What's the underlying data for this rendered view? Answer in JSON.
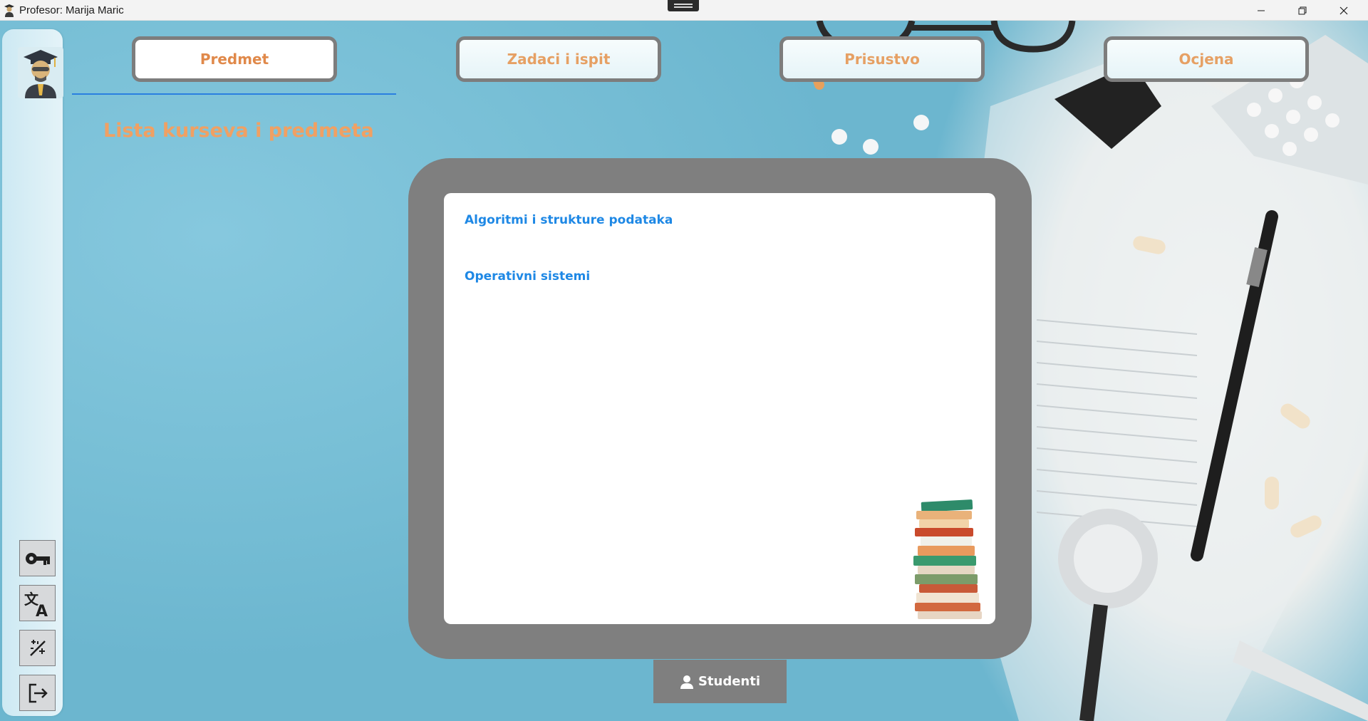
{
  "window": {
    "title": "Profesor: Marija Maric",
    "controls": {
      "minimize_icon": "minimize-icon",
      "maximize_icon": "restore-icon",
      "close_icon": "close-icon"
    }
  },
  "tabs": [
    {
      "label": "Predmet",
      "active": true
    },
    {
      "label": "Zadaci i ispit",
      "active": false
    },
    {
      "label": "Prisustvo",
      "active": false
    },
    {
      "label": "Ocjena",
      "active": false
    }
  ],
  "section_title": "Lista kurseva i predmeta",
  "courses": [
    "Algoritmi i strukture podataka",
    "Operativni sistemi"
  ],
  "students_button": {
    "label": "Studenti",
    "icon": "user-icon"
  },
  "sidebar": {
    "avatar_icon": "professor-avatar-icon",
    "buttons": [
      "key-icon",
      "translate-icon",
      "theme-toggle-icon",
      "logout-icon"
    ]
  },
  "colors": {
    "tab_text": "#e6a064",
    "accent_blue": "#1e88e5",
    "panel_frame": "#7f7f7f",
    "title_orange": "#f0a063"
  }
}
